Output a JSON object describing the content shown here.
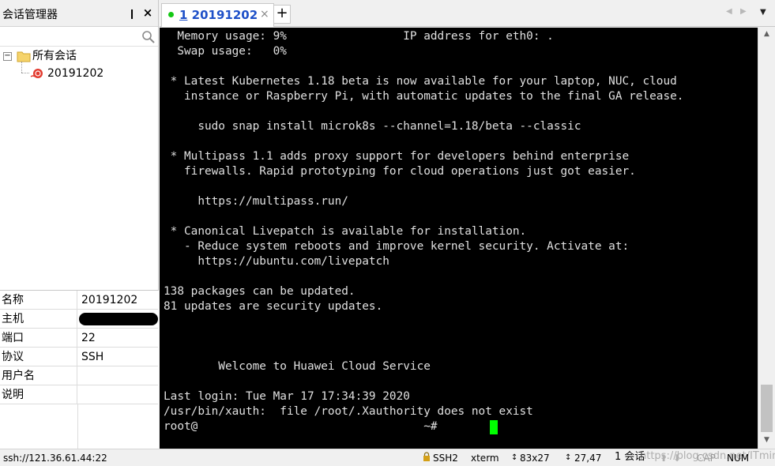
{
  "left_panel": {
    "title": "会话管理器",
    "pin_glyph": "❙",
    "close_glyph": "×",
    "search_placeholder": "",
    "tree": {
      "toggle_glyph": "−",
      "root_label": "所有会话",
      "child_label": "20191202"
    }
  },
  "properties": [
    {
      "key": "名称",
      "value": "20191202"
    },
    {
      "key": "主机",
      "value": ""
    },
    {
      "key": "端口",
      "value": "22"
    },
    {
      "key": "协议",
      "value": "SSH"
    },
    {
      "key": "用户名",
      "value": ""
    },
    {
      "key": "说明",
      "value": ""
    }
  ],
  "tabs": {
    "active": {
      "number": "1",
      "title": " 20191202",
      "close_glyph": "×"
    },
    "add_glyph": "+",
    "prev_glyph": "◀",
    "next_glyph": "▶",
    "menu_glyph": "▼"
  },
  "terminal": {
    "lines": [
      "  Memory usage: 9%                 IP address for eth0: .",
      "  Swap usage:   0%",
      "",
      " * Latest Kubernetes 1.18 beta is now available for your laptop, NUC, cloud",
      "   instance or Raspberry Pi, with automatic updates to the final GA release.",
      "",
      "     sudo snap install microk8s --channel=1.18/beta --classic",
      "",
      " * Multipass 1.1 adds proxy support for developers behind enterprise",
      "   firewalls. Rapid prototyping for cloud operations just got easier.",
      "",
      "     https://multipass.run/",
      "",
      " * Canonical Livepatch is available for installation.",
      "   - Reduce system reboots and improve kernel security. Activate at:",
      "     https://ubuntu.com/livepatch",
      "",
      "138 packages can be updated.",
      "81 updates are security updates.",
      "",
      "",
      "",
      "        Welcome to Huawei Cloud Service",
      "",
      "Last login: Tue Mar 17 17:34:39 2020",
      "/usr/bin/xauth:  file /root/.Xauthority does not exist",
      "root@                                 ~#"
    ],
    "cursor_color": "#00ff00"
  },
  "scrollbar": {
    "up_glyph": "▲",
    "down_glyph": "▼"
  },
  "status_bar": {
    "connection": "ssh://121.36.61.44:22",
    "protocol": "SSH2",
    "terminal_type": "xterm",
    "size_icon": "↕",
    "size": "83x27",
    "pos_icon": "↕",
    "position": "27,47",
    "sessions": "1 会话",
    "up_glyph": "⬆",
    "down_glyph": "⬇",
    "cap": "CAP",
    "num": "NUM",
    "watermark": "https://blog.csdn.net/ITmincherry"
  }
}
